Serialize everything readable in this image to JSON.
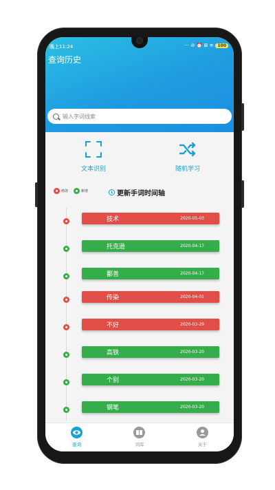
{
  "status_bar": {
    "time": "晚上11:24",
    "icons": "··· ⊘ ⏰ ⊠ ≋",
    "battery": "100"
  },
  "header": {
    "title": "查询历史"
  },
  "search": {
    "placeholder": "输入字词线索"
  },
  "quick_actions": [
    {
      "label": "文本识别",
      "icon": "scan-icon"
    },
    {
      "label": "随机学习",
      "icon": "shuffle-icon"
    }
  ],
  "legend": {
    "modify": "修改",
    "add": "新增"
  },
  "timeline": {
    "title": "更新手词时间轴",
    "entries": [
      {
        "word": "技术",
        "date": "2020-05-03",
        "type": "modify"
      },
      {
        "word": "托克逊",
        "date": "2020-04-17",
        "type": "add"
      },
      {
        "word": "鄱善",
        "date": "2020-04-17",
        "type": "add"
      },
      {
        "word": "传染",
        "date": "2020-04-01",
        "type": "modify"
      },
      {
        "word": "不好",
        "date": "2020-03-29",
        "type": "modify"
      },
      {
        "word": "高铁",
        "date": "2020-03-20",
        "type": "add"
      },
      {
        "word": "个别",
        "date": "2020-03-20",
        "type": "add"
      },
      {
        "word": "钢笔",
        "date": "2020-03-20",
        "type": "add"
      }
    ]
  },
  "nav": [
    {
      "label": "查询",
      "icon": "eye-icon",
      "active": true
    },
    {
      "label": "词库",
      "icon": "book-icon",
      "active": false
    },
    {
      "label": "关于",
      "icon": "person-icon",
      "active": false
    }
  ],
  "colors": {
    "accent": "#18a3cf",
    "modify": "#e14d47",
    "add": "#35ad4a"
  }
}
